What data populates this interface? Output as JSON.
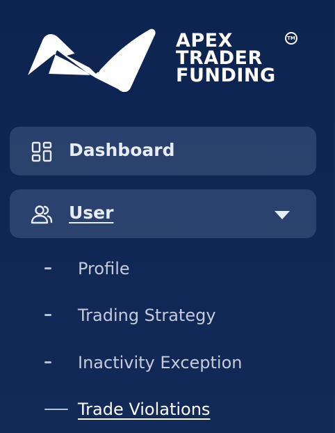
{
  "brand": {
    "line1": "APEX",
    "line2": "TRADER",
    "line3": "FUNDING",
    "trademark": "TM",
    "text_color": "#ffffff",
    "logo_icon": "apex-logo-icon"
  },
  "menu": {
    "dashboard": {
      "label": "Dashboard",
      "icon": "dashboard-grid-icon"
    },
    "user": {
      "label": "User",
      "icon": "users-icon",
      "expanded": true,
      "chevron": "chevron-down-icon",
      "children": [
        {
          "label": "Profile",
          "active": false
        },
        {
          "label": "Trading Strategy",
          "active": false
        },
        {
          "label": "Inactivity Exception",
          "active": false
        },
        {
          "label": "Trade Violations",
          "active": true
        }
      ]
    }
  },
  "colors": {
    "background": "#0f2450",
    "menu_item_bg": "#3a4a6e",
    "text": "#e8ecf5",
    "sub_text": "#c4cbdc"
  }
}
